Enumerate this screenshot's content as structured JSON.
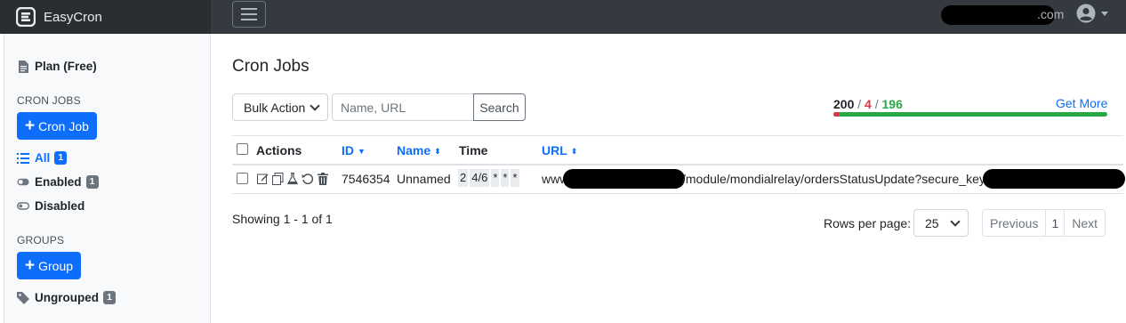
{
  "app": {
    "name": "EasyCron"
  },
  "header": {
    "user_email_suffix": ".com"
  },
  "sidebar": {
    "plan_label": "Plan (Free)",
    "cron_jobs_heading": "CRON JOBS",
    "add_cron_job_label": "Cron Job",
    "filters": [
      {
        "label": "All",
        "count": "1"
      },
      {
        "label": "Enabled",
        "count": "1"
      },
      {
        "label": "Disabled"
      }
    ],
    "groups_heading": "GROUPS",
    "add_group_label": "Group",
    "ungrouped": {
      "label": "Ungrouped",
      "count": "1"
    }
  },
  "main": {
    "title": "Cron Jobs",
    "bulk_action_label": "Bulk Action",
    "search_placeholder": "Name, URL",
    "search_button": "Search",
    "quota": {
      "total": "200",
      "used": "4",
      "remaining": "196",
      "separator": "/",
      "used_fraction": 0.02
    },
    "get_more_label": "Get More"
  },
  "table": {
    "columns": {
      "actions": "Actions",
      "id": "ID",
      "name": "Name",
      "time": "Time",
      "url": "URL"
    },
    "rows": [
      {
        "id": "7546354",
        "name": "Unnamed",
        "time_parts": [
          "2",
          "4/6",
          "*",
          "*",
          "*"
        ],
        "url_prefix": "www",
        "url_middle": "/module/mondialrelay/ordersStatusUpdate?secure_key"
      }
    ]
  },
  "footer": {
    "showing": "Showing 1 - 1 of 1",
    "rows_per_page_label": "Rows per page:",
    "rows_per_page_value": "25",
    "pager": {
      "previous": "Previous",
      "current": "1",
      "next": "Next"
    }
  },
  "colors": {
    "primary": "#0d6efd",
    "danger": "#dc3545",
    "success": "#28a745",
    "navbar": "#343a40"
  }
}
